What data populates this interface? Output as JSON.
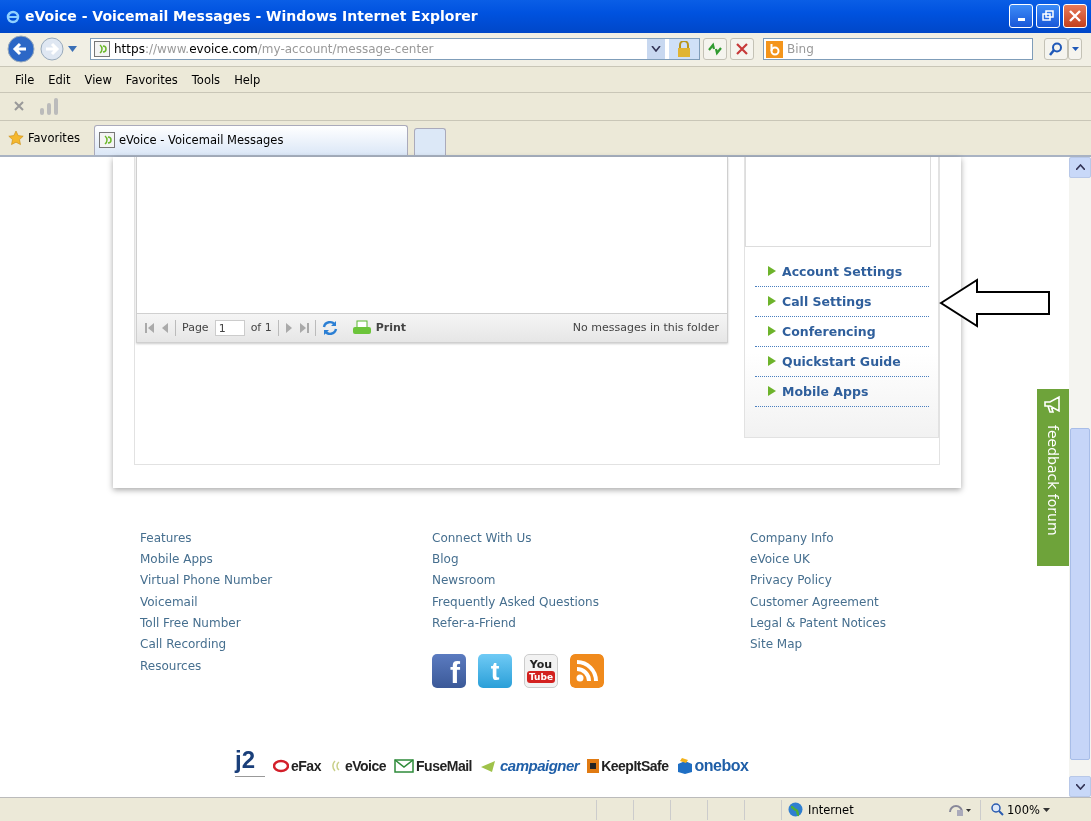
{
  "window": {
    "title": "eVoice - Voicemail Messages - Windows Internet Explorer"
  },
  "address_bar": {
    "url_parts": [
      {
        "text": "https",
        "emphasized": true
      },
      {
        "text": "://www.",
        "emphasized": false
      },
      {
        "text": "evoice.com",
        "emphasized": true
      },
      {
        "text": "/my-account/message-center",
        "emphasized": false
      }
    ]
  },
  "search": {
    "placeholder": "Bing"
  },
  "menu": [
    "File",
    "Edit",
    "View",
    "Favorites",
    "Tools",
    "Help"
  ],
  "favorites_bar": {
    "label": "Favorites",
    "tabs": [
      {
        "title": "eVoice - Voicemail Messages",
        "selected": true
      }
    ]
  },
  "grid_toolbar": {
    "page_label": "Page",
    "page_value": "1",
    "page_of": "of 1",
    "print": "Print",
    "status": "No messages in this folder"
  },
  "sidebar": {
    "links": [
      {
        "label": "Account Settings"
      },
      {
        "label": "Call Settings"
      },
      {
        "label": "Conferencing"
      },
      {
        "label": "Quickstart Guide"
      },
      {
        "label": "Mobile Apps"
      }
    ]
  },
  "feedback_tab": {
    "label": "feedback forum"
  },
  "footer": {
    "columns": [
      [
        "Features",
        "Mobile Apps",
        "Virtual Phone Number",
        "Voicemail",
        "Toll Free Number",
        "Call Recording",
        "Resources"
      ],
      [
        "Connect With Us",
        "Blog",
        "Newsroom",
        "Frequently Asked Questions",
        "Refer-a-Friend"
      ],
      [
        "Company Info",
        "eVoice UK",
        "Privacy Policy",
        "Customer Agreement",
        "Legal & Patent Notices",
        "Site Map"
      ]
    ],
    "social": [
      {
        "kind": "facebook",
        "glyph": "f"
      },
      {
        "kind": "twitter",
        "glyph": "t"
      },
      {
        "kind": "youtube",
        "lines": [
          "You",
          "Tube"
        ]
      },
      {
        "kind": "rss"
      }
    ]
  },
  "partners": [
    {
      "kind": "j2",
      "text": "j2"
    },
    {
      "kind": "efax",
      "text": "eFax"
    },
    {
      "kind": "evoice",
      "text": "eVoice"
    },
    {
      "kind": "fusemail",
      "text": "FuseMail"
    },
    {
      "kind": "campaigner",
      "text": "campaigner"
    },
    {
      "kind": "keepitsafe",
      "text": "KeepItSafe"
    },
    {
      "kind": "onebox",
      "text": "onebox"
    }
  ],
  "status_bar": {
    "zone": "Internet",
    "zoom": "100%"
  }
}
